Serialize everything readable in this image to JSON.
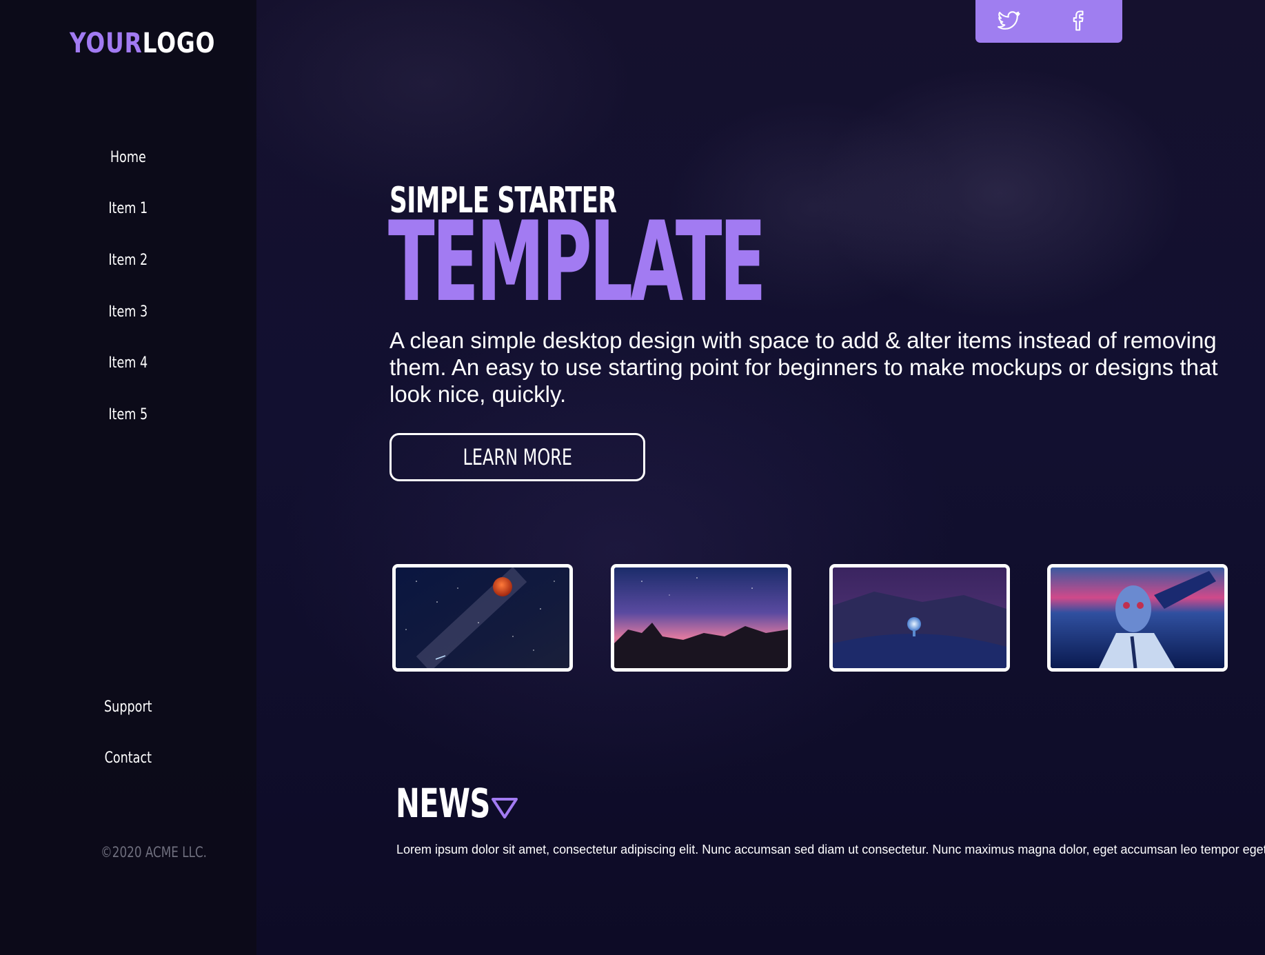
{
  "logo": {
    "part1": "YOUR",
    "part2": "LOGO"
  },
  "nav": {
    "items": [
      {
        "label": "Home"
      },
      {
        "label": "Item 1"
      },
      {
        "label": "Item 2"
      },
      {
        "label": "Item 3"
      },
      {
        "label": "Item 4"
      },
      {
        "label": "Item 5"
      }
    ],
    "bottom": [
      {
        "label": "Support"
      },
      {
        "label": "Contact"
      }
    ],
    "copyright": "©2020 ACME LLC."
  },
  "social": {
    "icons": [
      "twitter-icon",
      "facebook-icon"
    ],
    "background": "#9f7ef0"
  },
  "hero": {
    "subtitle": "SIMPLE STARTER",
    "title": "TEMPLATE",
    "description": "A clean simple desktop design with space to add & alter items instead of removing them. An easy to use starting point for beginners to make mockups or designs that look nice, quickly.",
    "button_label": "LEARN MORE"
  },
  "gallery": {
    "images": [
      "red-moon-night-sky",
      "pink-sky-over-rocks",
      "glowing-orb-snow-hill",
      "neon-cyborg-figure"
    ]
  },
  "news": {
    "title": "NEWS",
    "text": "Lorem ipsum dolor sit amet, consectetur adipiscing elit. Nunc accumsan sed diam ut consectetur. Nunc maximus magna dolor, eget accumsan leo tempor eget."
  },
  "colors": {
    "accent": "#a27bf2",
    "background": "#100c24",
    "sidebar": "#0c0b18",
    "muted": "#6f6f7e"
  }
}
